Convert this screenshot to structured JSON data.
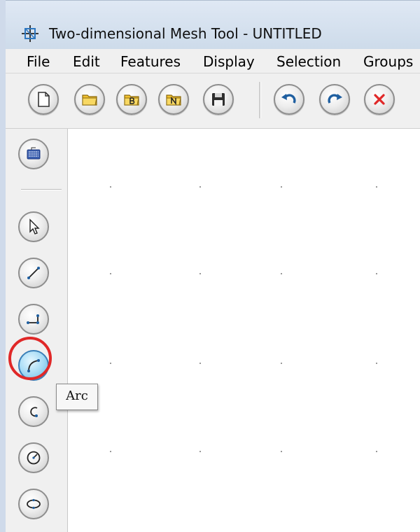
{
  "window": {
    "title": "Two-dimensional Mesh Tool - UNTITLED",
    "app_icon": "mesh-tool-icon"
  },
  "menubar": {
    "items": [
      "File",
      "Edit",
      "Features",
      "Display",
      "Selection",
      "Groups"
    ]
  },
  "toolbar": {
    "buttons": [
      {
        "name": "new-file-button",
        "icon": "blank-page-icon"
      },
      {
        "name": "open-folder-button",
        "icon": "folder-icon"
      },
      {
        "name": "open-folder-b-button",
        "icon": "folder-b-icon",
        "letter": "B"
      },
      {
        "name": "open-folder-n-button",
        "icon": "folder-n-icon",
        "letter": "N"
      },
      {
        "name": "save-button",
        "icon": "floppy-disk-icon"
      },
      {
        "name": "undo-button",
        "icon": "undo-arrow-icon"
      },
      {
        "name": "redo-button",
        "icon": "redo-arrow-icon"
      },
      {
        "name": "delete-button",
        "icon": "red-x-icon"
      }
    ]
  },
  "left_tools": {
    "buttons": [
      {
        "name": "keyboard-input-button",
        "icon": "keyboard-icon"
      },
      {
        "name": "select-tool-button",
        "icon": "arrow-cursor-icon"
      },
      {
        "name": "line-tool-button",
        "icon": "line-icon"
      },
      {
        "name": "polyline-tool-button",
        "icon": "polyline-icon"
      },
      {
        "name": "arc-tool-button",
        "icon": "arc-icon",
        "active": true
      },
      {
        "name": "curve-tool-button",
        "icon": "curve-icon"
      },
      {
        "name": "circle-tool-button",
        "icon": "circle-radius-icon"
      },
      {
        "name": "ellipse-tool-button",
        "icon": "ellipse-icon"
      }
    ]
  },
  "tooltip": {
    "text": "Arc"
  },
  "colors": {
    "accent_blue": "#1f5fa0",
    "highlight_red": "#e02828",
    "active_button": "#a6dbf5",
    "folder_yellow": "#f2c230"
  }
}
